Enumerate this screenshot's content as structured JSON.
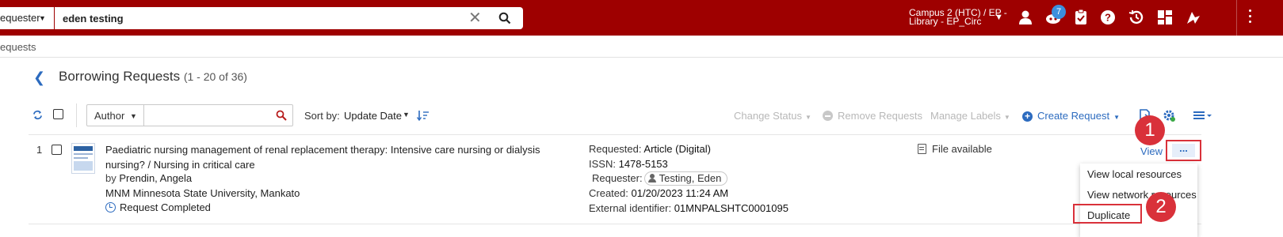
{
  "topbar": {
    "search_scope": "equester",
    "search_value": "eden testing",
    "location_line1": "Campus 2 (HTC) / EP -",
    "location_line2": "Library - EP_Circ",
    "notification_count": "7"
  },
  "breadcrumb": "equests",
  "page": {
    "title": "Borrowing Requests",
    "count": "(1 - 20 of 36)"
  },
  "toolbar": {
    "author_label": "Author",
    "sort_by_label": "Sort by:",
    "sort_value": "Update Date",
    "change_status": "Change Status",
    "remove_requests": "Remove Requests",
    "manage_labels": "Manage Labels",
    "create_request": "Create Request"
  },
  "rows": [
    {
      "number": "1",
      "title": "Paediatric nursing management of renal replacement therapy: Intensive care nursing or dialysis nursing? / Nursing in critical care",
      "by_label": "by",
      "author": "Prendin, Angela",
      "institution": "MNM Minnesota State University, Mankato",
      "status": "Request Completed",
      "requested_label": "Requested:",
      "requested_value": "Article (Digital)",
      "issn_label": "ISSN:",
      "issn_value": "1478-5153",
      "requester_label": "Requester:",
      "requester_value": "Testing, Eden",
      "created_label": "Created:",
      "created_value": "01/20/2023 11:24 AM",
      "external_label": "External identifier:",
      "external_value": "01MNPALSHTC0001095",
      "file_status": "File available",
      "view_label": "View",
      "more_label": "..."
    }
  ],
  "actions_menu": {
    "items": [
      "View local resources",
      "View network resources",
      "Duplicate"
    ]
  },
  "callouts": [
    "1",
    "2"
  ],
  "colors": {
    "topbar": "#9e0000",
    "accent": "#2c6bbf",
    "callout": "#d9313a"
  }
}
